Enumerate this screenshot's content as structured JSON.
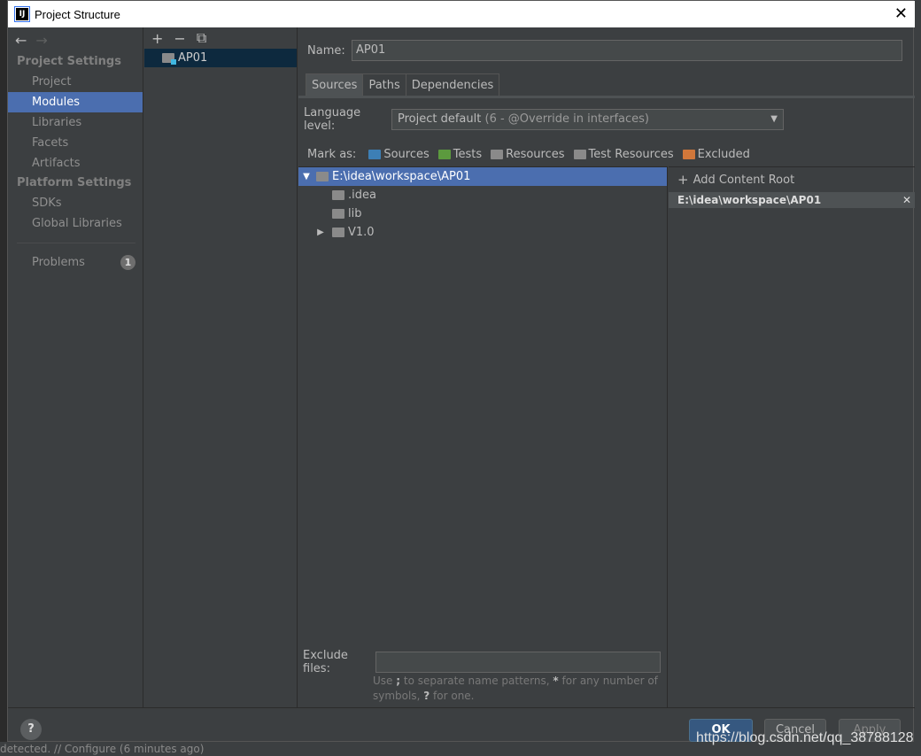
{
  "window": {
    "title": "Project Structure",
    "app_badge": "IJ"
  },
  "sidebar": {
    "project_settings_header": "Project Settings",
    "project_items": [
      {
        "label": "Project"
      },
      {
        "label": "Modules"
      },
      {
        "label": "Libraries"
      },
      {
        "label": "Facets"
      },
      {
        "label": "Artifacts"
      }
    ],
    "platform_settings_header": "Platform Settings",
    "platform_items": [
      {
        "label": "SDKs"
      },
      {
        "label": "Global Libraries"
      }
    ],
    "problems_label": "Problems",
    "problems_count": "1"
  },
  "modules": {
    "items": [
      {
        "label": "AP01"
      }
    ]
  },
  "main": {
    "name_label": "Name:",
    "name_value": "AP01",
    "tabs": [
      {
        "label": "Sources"
      },
      {
        "label": "Paths"
      },
      {
        "label": "Dependencies"
      }
    ],
    "language_label": "Language level:",
    "language_value": "Project default",
    "language_detail": "(6 - @Override in interfaces)",
    "mark_as_label": "Mark as:",
    "mark_as": [
      {
        "label": "Sources",
        "color": "#3d7fb5"
      },
      {
        "label": "Tests",
        "color": "#5c9a3e"
      },
      {
        "label": "Resources",
        "color": "#8a8a8a"
      },
      {
        "label": "Test Resources",
        "color": "#8a8a8a"
      },
      {
        "label": "Excluded",
        "color": "#d1773a"
      }
    ],
    "tree": [
      {
        "label": "E:\\idea\\workspace\\AP01"
      },
      {
        "label": ".idea"
      },
      {
        "label": "lib"
      },
      {
        "label": "V1.0"
      }
    ],
    "exclude_label": "Exclude files:",
    "hint_pre": "Use",
    "hint_sep": ";",
    "hint_mid": "to separate name patterns,",
    "hint_star": "*",
    "hint_after": "for any number of symbols,",
    "hint_q": "?",
    "hint_end": "for one.",
    "add_content_root": "Add Content Root",
    "content_root": "E:\\idea\\workspace\\AP01"
  },
  "footer": {
    "ok": "OK",
    "cancel": "Cancel",
    "apply": "Apply",
    "help": "?"
  },
  "background": {
    "status_text": "detected. // Configure (6 minutes ago)",
    "watermark": "https://blog.csdn.net/qq_38788128"
  }
}
